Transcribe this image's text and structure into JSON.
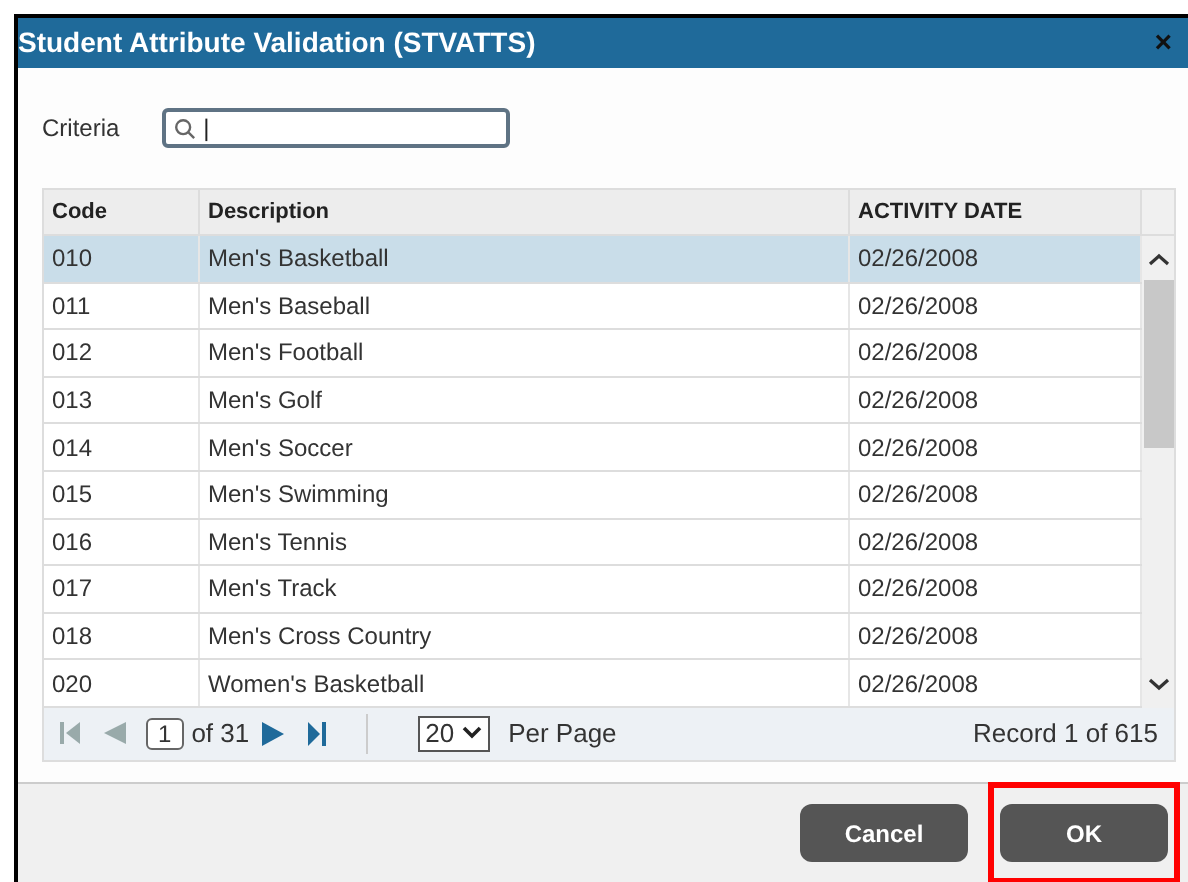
{
  "window": {
    "title": "Student Attribute Validation (STVATTS)",
    "close": "×"
  },
  "criteria": {
    "label": "Criteria",
    "value": "|"
  },
  "table": {
    "columns": [
      "Code",
      "Description",
      "ACTIVITY DATE"
    ],
    "rows": [
      {
        "cells": [
          "010",
          "Men's Basketball",
          "02/26/2008"
        ],
        "selected": true
      },
      {
        "cells": [
          "011",
          "Men's Baseball",
          "02/26/2008"
        ],
        "selected": false
      },
      {
        "cells": [
          "012",
          "Men's Football",
          "02/26/2008"
        ],
        "selected": false
      },
      {
        "cells": [
          "013",
          "Men's Golf",
          "02/26/2008"
        ],
        "selected": false
      },
      {
        "cells": [
          "014",
          "Men's Soccer",
          "02/26/2008"
        ],
        "selected": false
      },
      {
        "cells": [
          "015",
          "Men's Swimming",
          "02/26/2008"
        ],
        "selected": false
      },
      {
        "cells": [
          "016",
          "Men's Tennis",
          "02/26/2008"
        ],
        "selected": false
      },
      {
        "cells": [
          "017",
          "Men's Track",
          "02/26/2008"
        ],
        "selected": false
      },
      {
        "cells": [
          "018",
          "Men's Cross Country",
          "02/26/2008"
        ],
        "selected": false
      },
      {
        "cells": [
          "020",
          "Women's Basketball",
          "02/26/2008"
        ],
        "selected": false
      }
    ]
  },
  "pager": {
    "page": "1",
    "of": "of 31",
    "per_page": "20",
    "per_page_label": "Per Page",
    "record": "Record 1 of 615"
  },
  "buttons": [
    {
      "label": "Cancel",
      "highlighted": false
    },
    {
      "label": "OK",
      "highlighted": true
    }
  ]
}
